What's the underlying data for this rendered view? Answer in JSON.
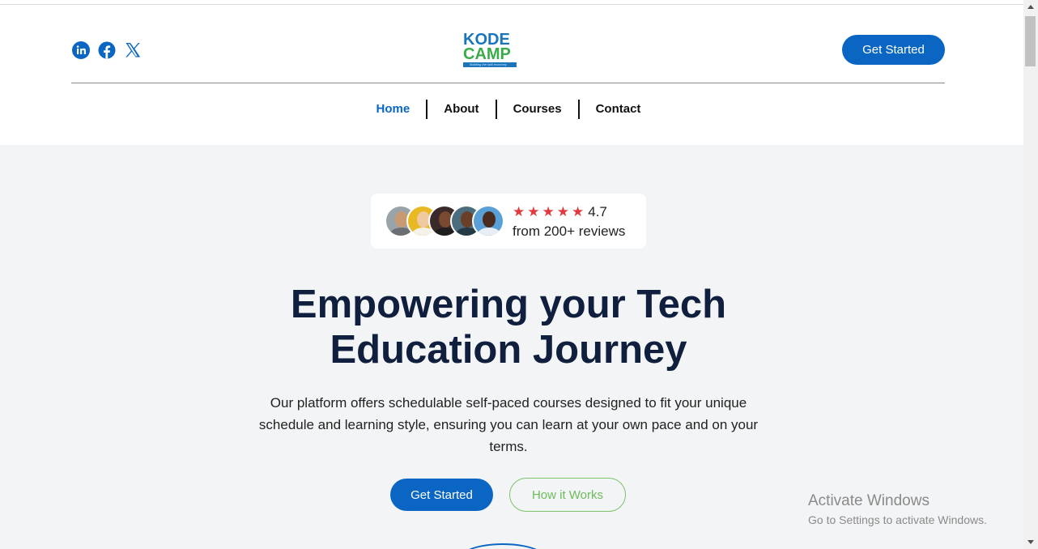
{
  "header": {
    "social_icons": [
      "linkedin-icon",
      "facebook-icon",
      "x-icon"
    ],
    "logo": {
      "word1": "KODE",
      "word2": "CAMP",
      "tagline": "Building the skill economy"
    },
    "cta_label": "Get Started"
  },
  "nav": {
    "items": [
      {
        "label": "Home",
        "active": true
      },
      {
        "label": "About",
        "active": false
      },
      {
        "label": "Courses",
        "active": false
      },
      {
        "label": "Contact",
        "active": false
      }
    ]
  },
  "reviews": {
    "stars": 5,
    "rating": "4.7",
    "text": "from 200+ reviews"
  },
  "hero": {
    "headline_line1": "Empowering your Tech",
    "headline_line2": "Education Journey",
    "subtext": "Our platform offers schedulable self-paced courses designed to fit your unique schedule and learning style, ensuring you can learn at your own pace and on your terms.",
    "primary_cta": "Get Started",
    "secondary_cta": "How it Works"
  },
  "watermark": {
    "title": "Activate Windows",
    "subtitle": "Go to Settings to activate Windows."
  },
  "colors": {
    "brand_blue": "#0a66c2",
    "headline": "#0f1f3d",
    "star_red": "#e0393e",
    "outline_green": "#7cc36a",
    "page_bg": "#f3f4f6"
  }
}
